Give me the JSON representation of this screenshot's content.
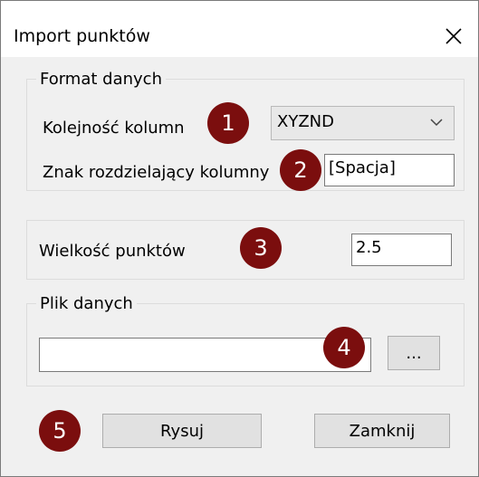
{
  "window": {
    "title": "Import punktów"
  },
  "format_group": {
    "legend": "Format danych",
    "column_order_label": "Kolejność kolumn",
    "column_order_value": "XYZND",
    "separator_label": "Znak rozdzielający kolumny",
    "separator_value": "[Spacja]"
  },
  "size_group": {
    "label": "Wielkość punktów",
    "value": "2.5"
  },
  "file_group": {
    "legend": "Plik danych",
    "path_value": "",
    "browse_label": "..."
  },
  "buttons": {
    "draw_label": "Rysuj",
    "close_label": "Zamknij"
  },
  "badges": [
    "1",
    "2",
    "3",
    "4",
    "5"
  ],
  "colors": {
    "badge": "#7b0e0e",
    "dialog_bg": "#f0f0f0",
    "title_bg": "#ffffff"
  },
  "icons": {
    "close": "close-icon",
    "dropdown": "chevron-down-icon"
  }
}
